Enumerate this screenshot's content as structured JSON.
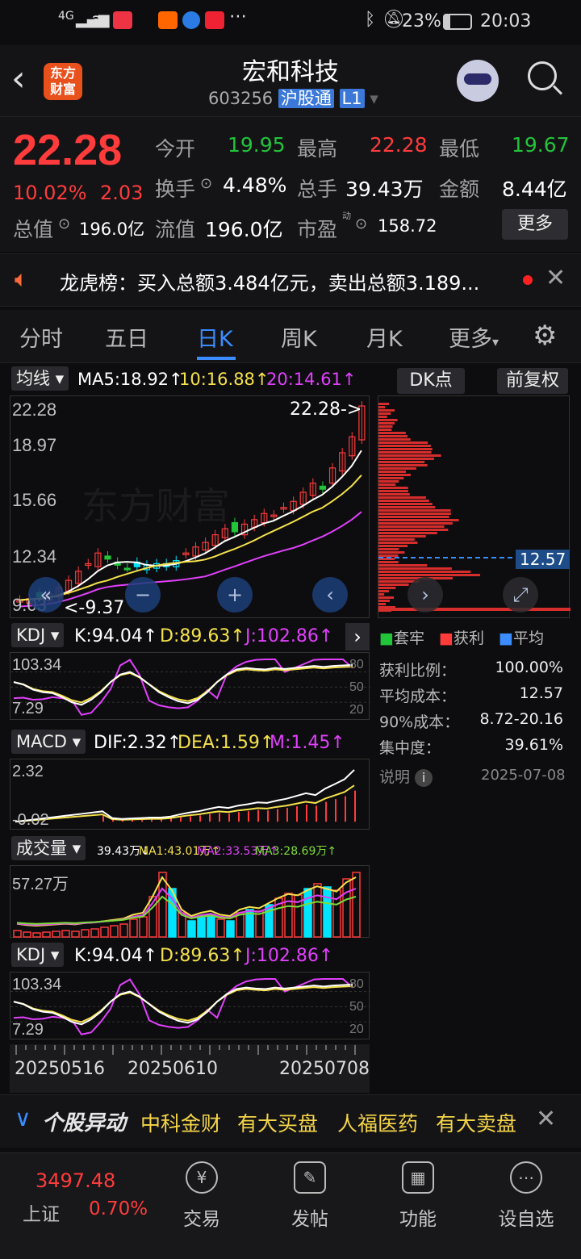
{
  "status_bar": {
    "network": "4G",
    "battery": "23%",
    "time": "20:03"
  },
  "header": {
    "logo_line1": "东方",
    "logo_line2": "财富",
    "title": "宏和科技",
    "code": "603256",
    "badge_hgt": "沪股通",
    "badge_level": "L1"
  },
  "quote": {
    "price": "22.28",
    "change_pct": "10.02%",
    "change": "2.03",
    "open_label": "今开",
    "open": "19.95",
    "high_label": "最高",
    "high": "22.28",
    "low_label": "最低",
    "low": "19.67",
    "turnover_label": "换手",
    "turnover": "4.48%",
    "volume_label": "总手",
    "volume": "39.43万",
    "amount_label": "金额",
    "amount": "8.44亿",
    "mcap_label": "总值",
    "mcap": "196.0亿",
    "float_label": "流值",
    "float_cap": "196.0亿",
    "pe_label": "市盈",
    "pe_sup": "动",
    "pe": "158.72",
    "more_button": "更多"
  },
  "notice": {
    "text": "龙虎榜：买入总额3.484亿元，卖出总额3.189..."
  },
  "tabs": [
    "分时",
    "五日",
    "日K",
    "周K",
    "月K",
    "更多"
  ],
  "ma_row": {
    "selector": "均线",
    "ma5": "MA5:18.92↑",
    "ma10": "10:16.88↑",
    "ma20": "20:14.61↑",
    "dk_button": "DK点",
    "adjust_button": "前复权"
  },
  "kline": {
    "y_labels": [
      "22.28",
      "18.97",
      "15.66",
      "12.34",
      "9.03"
    ],
    "high_marker": "22.28->",
    "low_marker": "<-9.37",
    "watermark": "东方财富",
    "cost_marker": "12.57"
  },
  "chip_legend": {
    "trapped": "套牢",
    "profit": "获利",
    "average": "平均"
  },
  "chip_stats": [
    {
      "label": "获利比例：",
      "value": "100.00%"
    },
    {
      "label": "平均成本：",
      "value": "12.57"
    },
    {
      "label": "90%成本：",
      "value": "8.72-20.16"
    },
    {
      "label": "集中度：",
      "value": "39.61%"
    }
  ],
  "chip_note": {
    "label": "说明",
    "date": "2025-07-08"
  },
  "kdj": {
    "selector": "KDJ",
    "k": "K:94.04↑",
    "d": "D:89.63↑",
    "j": "J:102.86↑",
    "y_top": "103.34",
    "y_bottom": "7.29",
    "l80": "80",
    "l50": "50",
    "l20": "20"
  },
  "macd": {
    "selector": "MACD",
    "dif": "DIF:2.32↑",
    "dea": "DEA:1.59↑",
    "m": "M:1.45↑",
    "y_top": "2.32",
    "y_bottom": "-0.02"
  },
  "volume": {
    "selector": "成交量",
    "vol": "39.43万↓",
    "ma1": "MA1:43.01万↑",
    "ma2": "MA2:33.53万↑",
    "ma3": "MA3:28.69万↑",
    "y_top": "57.27万"
  },
  "dates": [
    "20250516",
    "20250610",
    "20250708"
  ],
  "ticker": {
    "title": "个股异动",
    "items": [
      "中科金财",
      "有大买盘",
      "人福医药",
      "有大卖盘"
    ]
  },
  "bottom_nav": {
    "index_value": "3497.48",
    "index_name": "上证",
    "index_pct": "0.70%",
    "items": [
      "交易",
      "发帖",
      "功能",
      "设自选"
    ]
  },
  "colors": {
    "up": "#ff3b3b",
    "down": "#22c43a",
    "accent": "#3b8cff",
    "cyan": "#00e5ff",
    "yellow": "#f5e14b",
    "magenta": "#e040fb"
  }
}
